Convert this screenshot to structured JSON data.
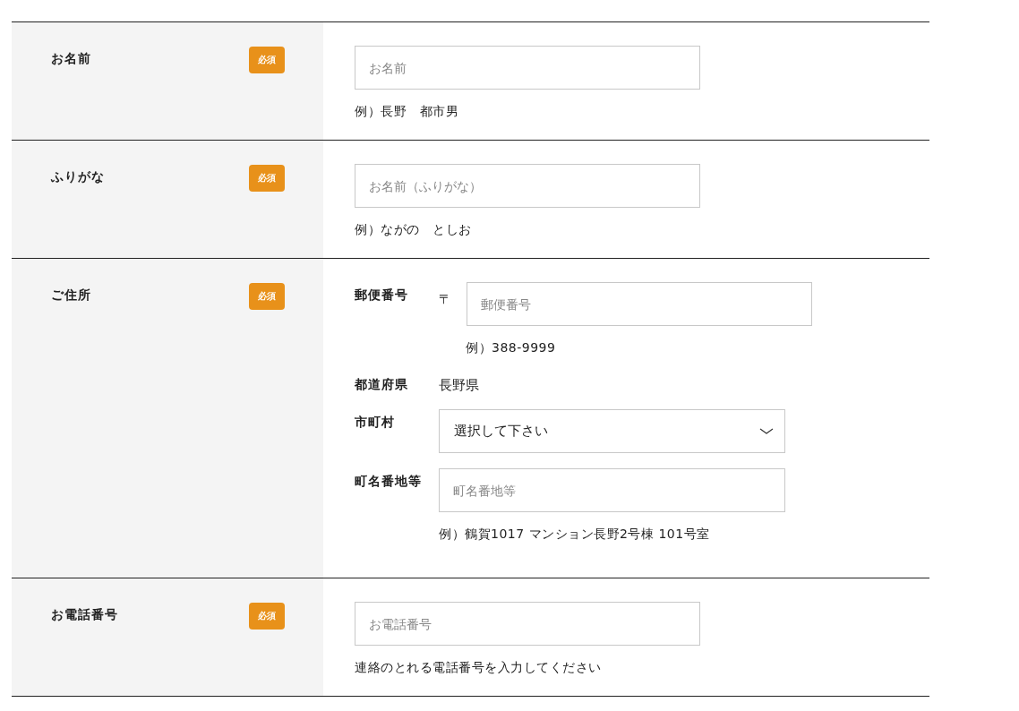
{
  "rows": [
    {
      "kind": "simple",
      "label": "お名前",
      "badge": "必須",
      "placeholder": "お名前",
      "hint": "例）長野　都市男"
    },
    {
      "kind": "simple",
      "label": "ふりがな",
      "badge": "必須",
      "placeholder": "お名前（ふりがな）",
      "hint": "例）ながの　としお"
    },
    {
      "kind": "address",
      "label": "ご住所",
      "badge": "必須",
      "fields": [
        {
          "kind": "postal",
          "label": "郵便番号",
          "mark": "〒",
          "placeholder": "郵便番号",
          "hint": "例）388-9999"
        },
        {
          "kind": "static",
          "label": "都道府県",
          "value": "長野県"
        },
        {
          "kind": "select",
          "label": "市町村",
          "value": "選択して下さい"
        },
        {
          "kind": "input",
          "label": "町名番地等",
          "placeholder": "町名番地等",
          "hint": "例）鶴賀1017 マンション長野2号棟 101号室"
        }
      ]
    },
    {
      "kind": "simple",
      "label": "お電話番号",
      "badge": "必須",
      "placeholder": "お電話番号",
      "hint": "連絡のとれる電話番号を入力してください"
    }
  ]
}
